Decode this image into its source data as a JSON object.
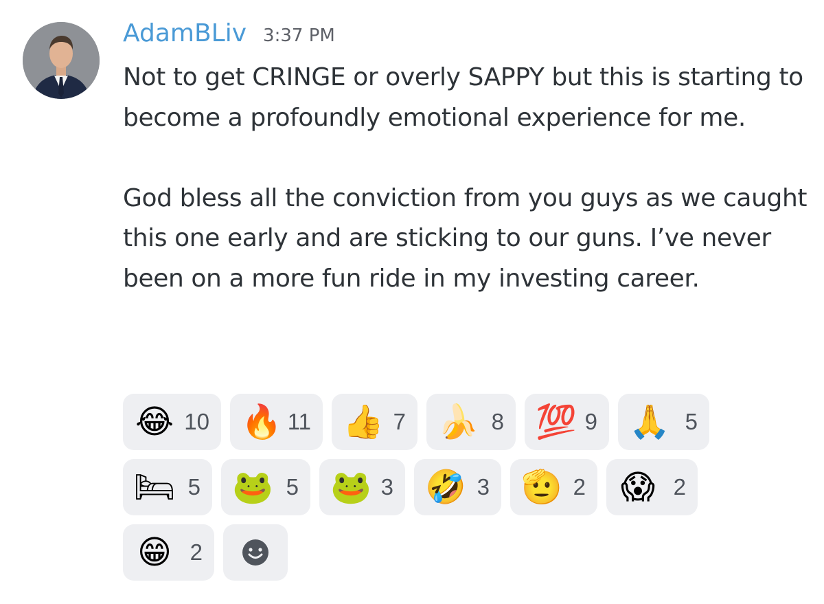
{
  "message": {
    "author": "AdamBLiv",
    "timestamp": "3:37 PM",
    "paragraphs": [
      "Not to get CRINGE or overly SAPPY but this is starting to become a profoundly emotional experience for me.",
      "God bless all the conviction from you guys as we caught this one early and are sticking to our guns. I’ve never been on a more fun ride in my investing career."
    ]
  },
  "reactions": [
    {
      "icon": "face-with-tears-of-joy-emoji",
      "glyph": "😂",
      "count": "10"
    },
    {
      "icon": "fire-emoji",
      "glyph": "🔥",
      "count": "11"
    },
    {
      "icon": "thumbs-up-emoji",
      "glyph": "👍",
      "count": "7"
    },
    {
      "icon": "dancing-banana-emoji",
      "glyph": "🍌",
      "count": "8"
    },
    {
      "icon": "hundred-points-emoji",
      "glyph": "💯",
      "count": "9"
    },
    {
      "icon": "praying-hands-coins-emoji",
      "glyph": "🙏",
      "count": "5"
    },
    {
      "icon": "pepe-bed-emoji",
      "glyph": "🛏",
      "count": "5"
    },
    {
      "icon": "pepe-crying-emoji",
      "glyph": "🐸",
      "count": "5"
    },
    {
      "icon": "pepe-thinking-emoji",
      "glyph": "🐸",
      "count": "3"
    },
    {
      "icon": "rolling-on-floor-laughing-emoji",
      "glyph": "🤣",
      "count": "3"
    },
    {
      "icon": "saluting-face-emoji",
      "glyph": "🫡",
      "count": "2"
    },
    {
      "icon": "manga-face-emoji",
      "glyph": "😱",
      "count": "2"
    },
    {
      "icon": "smiling-man-emoji",
      "glyph": "😁",
      "count": "2"
    }
  ],
  "add_reaction": {
    "icon": "add-reaction-smiley-icon"
  },
  "colors": {
    "username": "#4a9ad6",
    "text": "#2e3338",
    "timestamp": "#5e6168",
    "reaction_bg": "#eeeff2",
    "reaction_count": "#4f545c"
  }
}
